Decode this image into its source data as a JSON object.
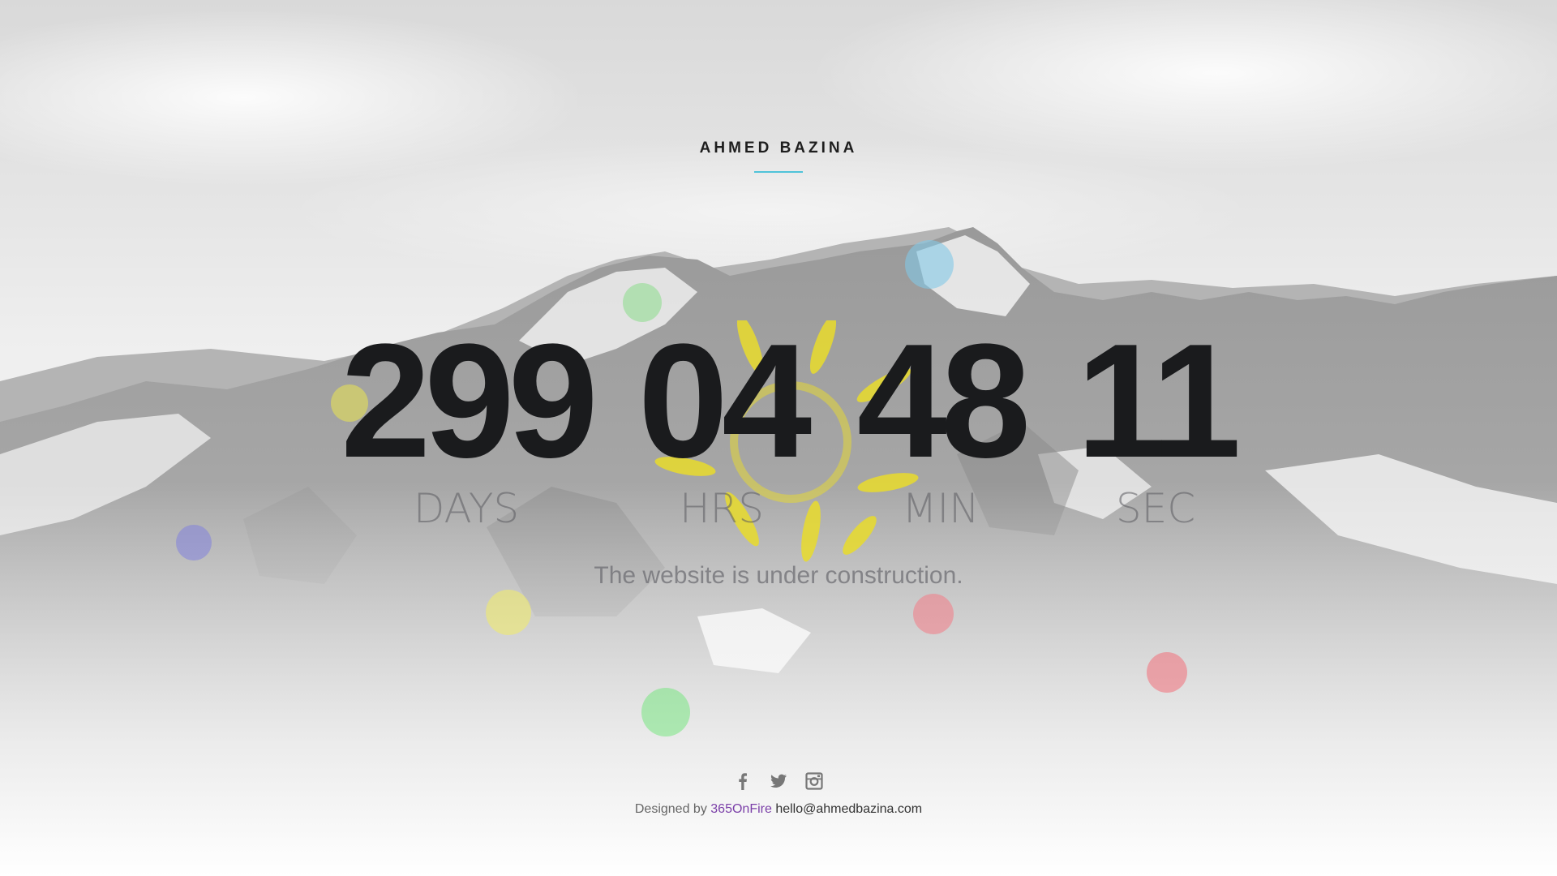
{
  "brand": {
    "name": "AHMED BAZINA",
    "accent_color": "#4fc3d9"
  },
  "countdown": {
    "days": {
      "value": "299",
      "label": "DAYS"
    },
    "hours": {
      "value": "04",
      "label": "HRS"
    },
    "minutes": {
      "value": "48",
      "label": "MIN"
    },
    "seconds": {
      "value": "11",
      "label": "SEC"
    }
  },
  "tagline": "The website is under construction.",
  "socials": [
    {
      "icon": "facebook-icon"
    },
    {
      "icon": "twitter-icon"
    },
    {
      "icon": "instagram-icon"
    }
  ],
  "footer": {
    "designed_by_prefix": "Designed by",
    "designer_link": "365OnFire",
    "email": "hello@ahmedbazina.com"
  },
  "colors": {
    "background": "#e4e4e4",
    "digits": "#1a1b1d",
    "link": "#7b3fa8"
  }
}
